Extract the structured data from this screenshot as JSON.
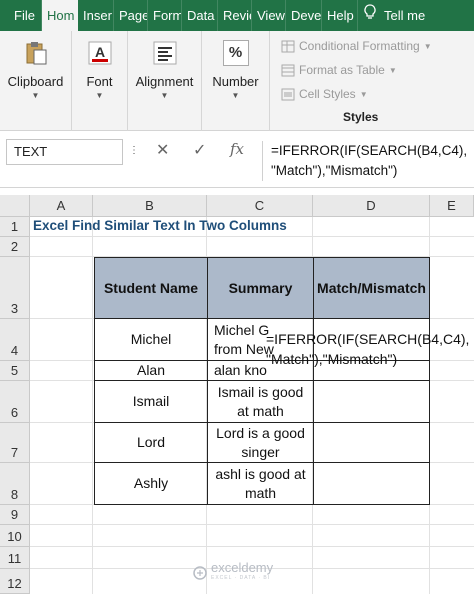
{
  "ribbon": {
    "tabs": [
      "File",
      "Hom",
      "Inser",
      "Page",
      "Form",
      "Data",
      "Revie",
      "View",
      "Deve",
      "Help",
      "Tell me"
    ],
    "active_tab_index": 1,
    "groups": {
      "clipboard": "Clipboard",
      "font": "Font",
      "alignment": "Alignment",
      "number": "Number",
      "number_icon": "%"
    },
    "styles": {
      "conditional_formatting": "Conditional Formatting",
      "format_as_table": "Format as Table",
      "cell_styles": "Cell Styles",
      "label": "Styles"
    }
  },
  "formula_bar": {
    "name_box": "TEXT",
    "cancel": "✕",
    "enter": "✓",
    "fx": "fx",
    "formula_line1": "=IFERROR(IF(SEARCH(B4,C4),",
    "formula_line2": "\"Match\"),\"Mismatch\")"
  },
  "grid": {
    "columns": [
      "A",
      "B",
      "C",
      "D",
      "E"
    ],
    "rows": [
      "1",
      "2",
      "3",
      "4",
      "5",
      "6",
      "7",
      "8",
      "9",
      "10",
      "11",
      "12"
    ],
    "title": "Excel Find Similar Text In Two Columns",
    "headers": [
      "Student Name",
      "Summary",
      "Match/Mismatch"
    ],
    "data_rows": [
      {
        "name": "Michel",
        "summary_line1": "Michel G",
        "summary_line2": "from New"
      },
      {
        "name": "Alan",
        "summary_line1": "alan kno",
        "summary_line2": ""
      },
      {
        "name": "Ismail",
        "summary_line1": "Ismail is good",
        "summary_line2": "at math"
      },
      {
        "name": "Lord",
        "summary_line1": "Lord is a good",
        "summary_line2": "singer"
      },
      {
        "name": "Ashly",
        "summary_line1": "ashl is good at",
        "summary_line2": "math"
      }
    ],
    "editing_formula_line1": "=IFERROR(IF(SEARCH(B4,C4),",
    "editing_formula_line2": "\"Match\"),\"Mismatch\")"
  },
  "watermark": {
    "brand": "exceldemy",
    "tagline": "EXCEL · DATA · BI"
  },
  "colors": {
    "ribbon_green": "#217346",
    "header_fill": "#acb9ca",
    "title_blue": "#1f4e79"
  }
}
